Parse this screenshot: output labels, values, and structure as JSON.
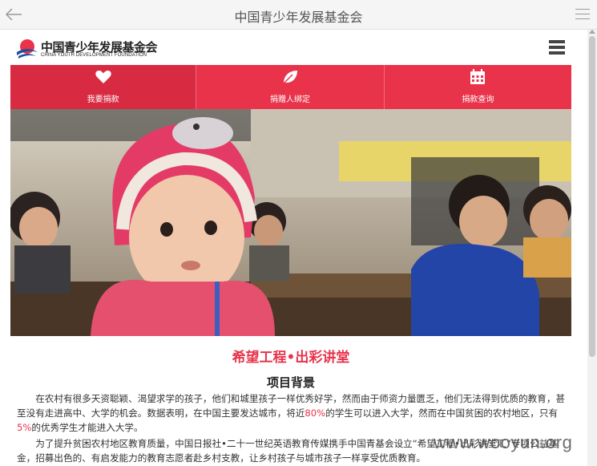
{
  "appbar": {
    "title": "中国青少年发展基金会"
  },
  "logo": {
    "name_cn": "中国青少年发展基金会",
    "name_en": "CHINA YOUTH DEVELOPMENT FOUNDATION"
  },
  "nav": {
    "items": [
      {
        "label": "我要捐款",
        "icon": "heart-icon",
        "active": true
      },
      {
        "label": "捐赠人绑定",
        "icon": "leaf-icon",
        "active": false
      },
      {
        "label": "捐款查询",
        "icon": "calendar-icon",
        "active": false
      }
    ]
  },
  "article": {
    "headline": "希望工程•出彩讲堂",
    "subhead": "项目背景",
    "p1_a": "在农村有很多天资聪颖、渴望求学的孩子，他们和城里孩子一样优秀好学，然而由于师资力量匮乏，他们无法得到优质的教育，甚至没有走进高中、大学的机会。数据表明，在中国主要发达城市，将近",
    "p1_pct1": "80%",
    "p1_b": "的学生可以进入大学，然而在中国贫困的农村地区，只有",
    "p1_pct2": "5%",
    "p1_c": "的优秀学生才能进入大学。",
    "p2": "为了提升贫困农村地区教育质量，中国日报社•二十一世纪英语教育传媒携手中国青基会设立“希望工程•出彩讲堂汇”专项公益基金，招募出色的、有启发能力的教育志愿者赴乡村支教，让乡村孩子与城市孩子一样享受优质教育。"
  },
  "watermark": "www.wooyun.org",
  "colors": {
    "accent": "#e8334a",
    "nav_active": "#d82a41"
  }
}
